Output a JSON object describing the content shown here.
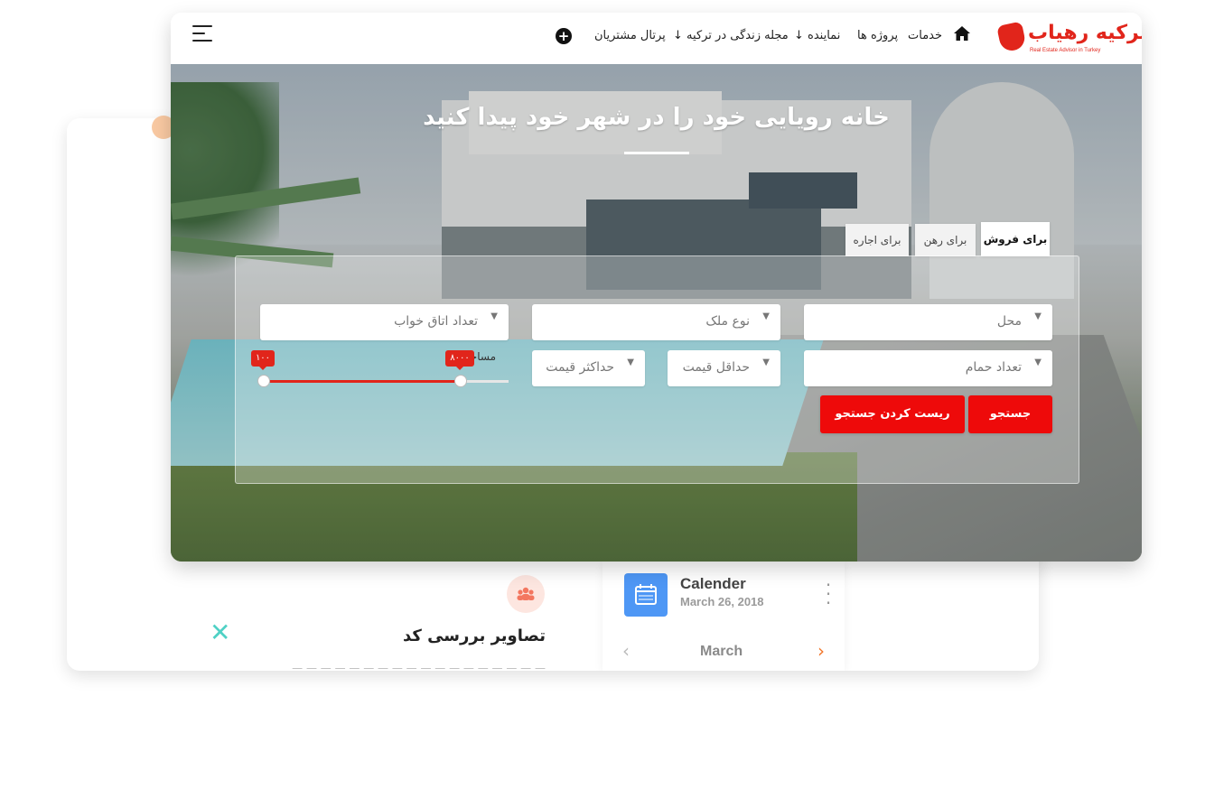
{
  "brand": {
    "logo_text": "ترکیه رهیاب",
    "tagline": "Real Estate Advisor in Turkey",
    "accent": "#e1251b"
  },
  "nav": {
    "home_icon": "home-icon",
    "items": [
      {
        "label": "خدمات"
      },
      {
        "label": "پروژه ها"
      },
      {
        "label": "نماینده"
      },
      {
        "label": "مجله زندگی در ترکیه"
      },
      {
        "label": "پرتال مشتریان"
      }
    ],
    "dropdown_indicator": "↓",
    "plus_icon": "plus-circle-icon",
    "menu_icon": "hamburger-icon"
  },
  "hero": {
    "title": "خانه رویایی خود را در شهر خود پیدا کنید"
  },
  "tabs": [
    {
      "label": "برای فروش",
      "active": true
    },
    {
      "label": "برای رهن",
      "active": false
    },
    {
      "label": "برای اجاره",
      "active": false
    }
  ],
  "search": {
    "location": "محل",
    "property_type": "نوع ملک",
    "bedrooms": "تعداد اتاق خواب",
    "bathrooms": "تعداد حمام",
    "min_price": "حداقل قیمت",
    "max_price": "حداکثر قیمت",
    "area_label": "مساحت",
    "area_min": "۱۰۰",
    "area_max": "۸۰۰۰",
    "search_button": "جستجو",
    "reset_button": "ریست کردن جستجو"
  },
  "background_card": {
    "feature_title": "تصاویر بررسی کد",
    "team_icon": "team-icon",
    "calendar": {
      "title": "Calender",
      "date": "March 26, 2018",
      "month": "March"
    }
  }
}
